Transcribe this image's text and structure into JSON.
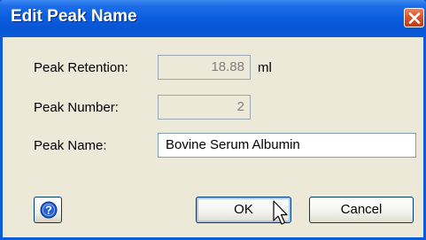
{
  "window": {
    "title": "Edit Peak Name"
  },
  "form": {
    "retention_label": "Peak Retention:",
    "retention_value": "18.88",
    "retention_unit": "ml",
    "number_label": "Peak Number:",
    "number_value": "2",
    "name_label": "Peak Name:",
    "name_value": "Bovine Serum Albumin"
  },
  "buttons": {
    "ok_label": "OK",
    "cancel_label": "Cancel"
  },
  "icons": {
    "close": "close-icon",
    "help": "help-icon",
    "cursor": "arrow-cursor-icon"
  },
  "colors": {
    "titlebar": "#0a5bd8",
    "dialog_bg": "#ece9d8",
    "close_button": "#d9502c",
    "help_icon": "#1f5fd0"
  }
}
